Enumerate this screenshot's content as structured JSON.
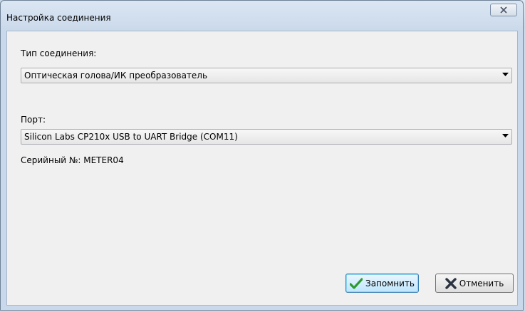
{
  "window": {
    "title": "Настройка соединения"
  },
  "connection_type": {
    "label": "Тип соединения:",
    "selected": "Оптическая голова/ИК преобразователь"
  },
  "port": {
    "label": "Порт:",
    "selected": "Silicon Labs CP210x USB to UART Bridge (COM11)"
  },
  "serial": {
    "text": "Серийный №: METER04"
  },
  "buttons": {
    "save_label": "Запомнить",
    "cancel_label": "Отменить"
  },
  "icons": {
    "close": "close-icon",
    "dropdown": "chevron-down-icon",
    "save": "checkmark-icon",
    "cancel": "cross-icon"
  },
  "colors": {
    "save_icon": "#2e9a2e",
    "cancel_icon": "#2b3340"
  }
}
